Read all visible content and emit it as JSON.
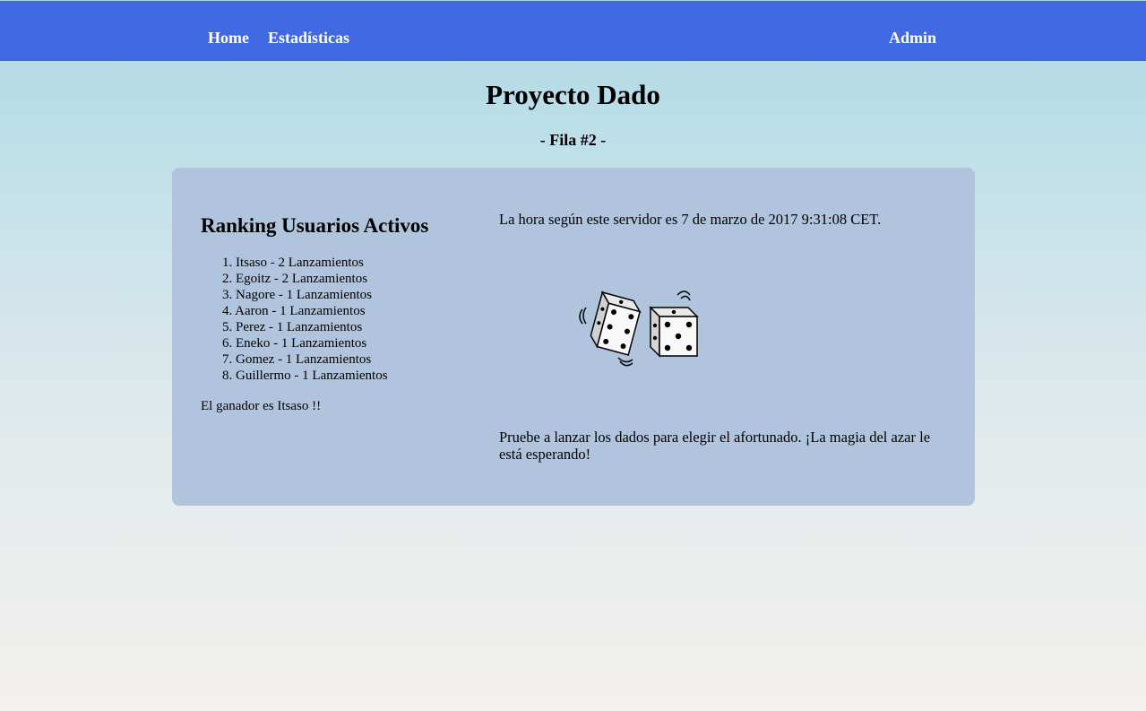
{
  "nav": {
    "home": "Home",
    "stats": "Estadísticas",
    "admin": "Admin"
  },
  "header": {
    "title": "Proyecto Dado",
    "subtitle": "- Fila #2 -"
  },
  "ranking": {
    "title": "Ranking Usuarios Activos",
    "items": [
      "1. Itsaso - 2 Lanzamientos",
      "2. Egoitz - 2 Lanzamientos",
      "3. Nagore - 1 Lanzamientos",
      "4. Aaron - 1 Lanzamientos",
      "5. Perez - 1 Lanzamientos",
      "6. Eneko - 1 Lanzamientos",
      "7. Gomez - 1 Lanzamientos",
      "8. Guillermo - 1 Lanzamientos"
    ],
    "winner": "El ganador es Itsaso !!"
  },
  "main": {
    "server_time": "La hora según este servidor es 7 de marzo de 2017 9:31:08 CET.",
    "dice_icon": "dice-icon",
    "invite": "Pruebe a lanzar los dados para elegir el afortunado. ¡La magia del azar le está esperando!"
  },
  "colors": {
    "navbar": "#4169e1",
    "panel": "#b0c4de",
    "background_top": "#add8e6",
    "background_bottom": "#f3f1ee"
  }
}
